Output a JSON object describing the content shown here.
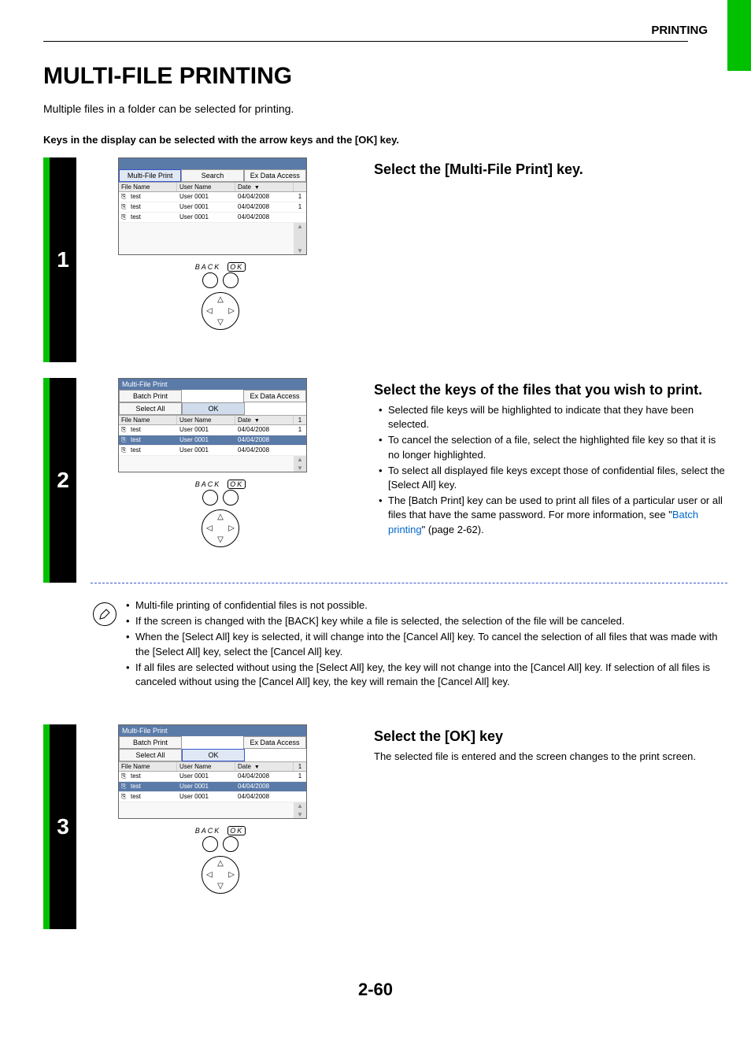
{
  "header": {
    "section": "PRINTING"
  },
  "title": "MULTI-FILE PRINTING",
  "intro": "Multiple files in a folder can be selected for printing.",
  "keys_line": "Keys in the display can be selected with the arrow keys and the [OK] key.",
  "page_number": "2-60",
  "controls": {
    "back": "BACK",
    "ok": "OK",
    "up": "△",
    "down": "▽",
    "left": "◁",
    "right": "▷"
  },
  "step1": {
    "num": "1",
    "heading": "Select the [Multi-File Print] key.",
    "screen": {
      "title": "",
      "buttons": [
        "Multi-File Print",
        "Search",
        "Ex Data Access"
      ],
      "columns": [
        "File Name",
        "User Name",
        "Date",
        ""
      ],
      "date_sort": "▼",
      "rows": [
        {
          "file": "test",
          "user": "User 0001",
          "date": "04/04/2008",
          "n": "1"
        },
        {
          "file": "test",
          "user": "User 0001",
          "date": "04/04/2008",
          "n": "1"
        },
        {
          "file": "test",
          "user": "User 0001",
          "date": "04/04/2008",
          "n": ""
        }
      ]
    }
  },
  "step2": {
    "num": "2",
    "heading": "Select the keys of the files that you wish to print.",
    "bullets": [
      "Selected file keys will be highlighted to indicate that they have been selected.",
      "To cancel the selection of a file, select the highlighted file key so that it is no longer highlighted.",
      "To select all displayed file keys except those of confidential files, select the [Select All] key.",
      "The [Batch Print] key can be used to print all files of a particular user or all files that have the same password. For more information, see \""
    ],
    "link_text": "Batch printing",
    "link_tail": "\" (page 2-62).",
    "screen": {
      "title": "Multi-File Print",
      "buttons_top": [
        "Batch Print",
        "",
        "Ex Data Access"
      ],
      "buttons_second": [
        "Select All",
        "OK",
        ""
      ],
      "columns": [
        "File Name",
        "User Name",
        "Date",
        ""
      ],
      "date_sort": "▼",
      "col_end": "1",
      "rows": [
        {
          "file": "test",
          "user": "User 0001",
          "date": "04/04/2008",
          "n": "1",
          "hl": false
        },
        {
          "file": "test",
          "user": "User 0001",
          "date": "04/04/2008",
          "n": "",
          "hl": true
        },
        {
          "file": "test",
          "user": "User 0001",
          "date": "04/04/2008",
          "n": "",
          "hl": false
        }
      ]
    },
    "notes": [
      "Multi-file printing of confidential files is not possible.",
      "If the screen is changed with the [BACK] key while a file is selected, the selection of the file will be canceled.",
      "When the [Select All] key is selected, it will change into the [Cancel All] key. To cancel the selection of all files that was made with the [Select All] key, select the [Cancel All] key.",
      "If all files are selected without using the [Select All] key, the key will not change into the [Cancel All] key. If selection of all files is canceled without using the [Cancel All] key, the key will remain the [Cancel All] key."
    ]
  },
  "step3": {
    "num": "3",
    "heading": "Select the [OK] key",
    "body": "The selected file is entered and the screen changes to the print screen.",
    "screen": {
      "title": "Multi-File Print",
      "buttons_top": [
        "Batch Print",
        "",
        "Ex Data Access"
      ],
      "buttons_second": [
        "Select All",
        "OK",
        ""
      ],
      "columns": [
        "File Name",
        "User Name",
        "Date",
        ""
      ],
      "date_sort": "▼",
      "col_end": "1",
      "rows": [
        {
          "file": "test",
          "user": "User 0001",
          "date": "04/04/2008",
          "n": "1",
          "hl": false
        },
        {
          "file": "test",
          "user": "User 0001",
          "date": "04/04/2008",
          "n": "",
          "hl": true
        },
        {
          "file": "test",
          "user": "User 0001",
          "date": "04/04/2008",
          "n": "",
          "hl": false
        }
      ]
    }
  }
}
